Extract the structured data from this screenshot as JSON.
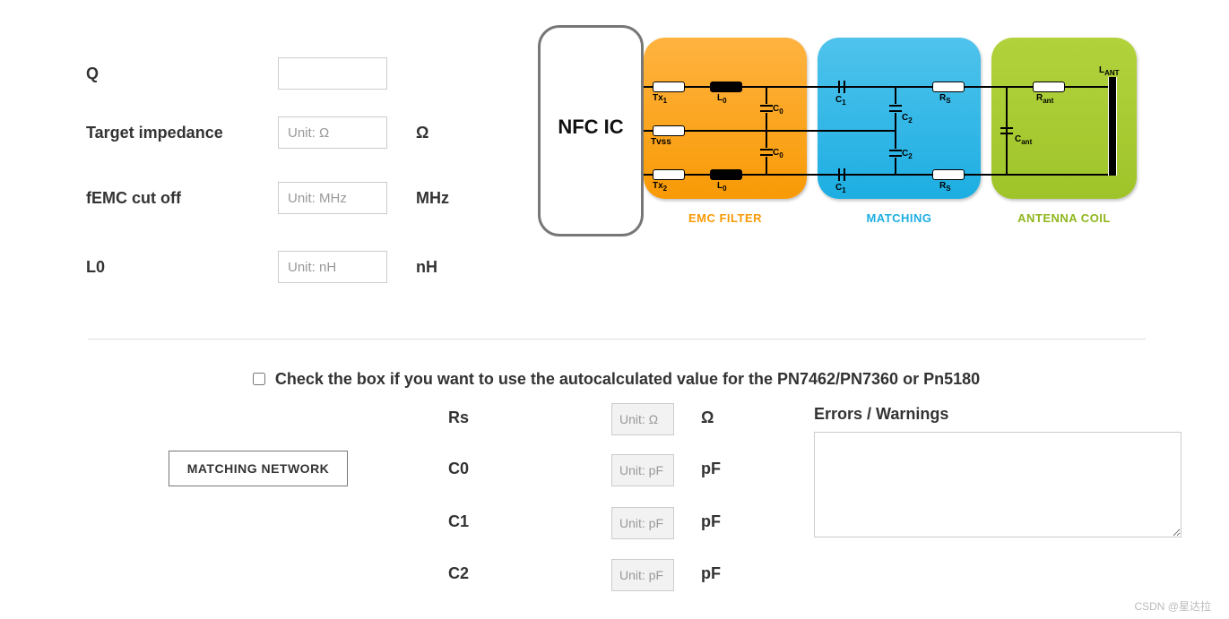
{
  "params": {
    "q": {
      "label": "Q",
      "placeholder": "",
      "unit": ""
    },
    "zt": {
      "label": "Target impedance",
      "placeholder": "Unit: Ω",
      "unit": "Ω"
    },
    "femc": {
      "label": "fEMC cut off",
      "placeholder": "Unit: MHz",
      "unit": "MHz"
    },
    "l0": {
      "label": "L0",
      "placeholder": "Unit: nH",
      "unit": "nH"
    }
  },
  "diagram": {
    "nfc_ic": "NFC IC",
    "stage_emc": "EMC FILTER",
    "stage_match": "MATCHING",
    "stage_ant": "ANTENNA COIL",
    "labels": {
      "tx1": "Tx",
      "tx1_sub": "1",
      "tx2": "Tx",
      "tx2_sub": "2",
      "tvss": "Tvss",
      "l0": "L",
      "l0_sub": "0",
      "c0": "C",
      "c0_sub": "0",
      "c1": "C",
      "c1_sub": "1",
      "c2": "C",
      "c2_sub": "2",
      "rs": "R",
      "rs_sub": "S",
      "rant": "R",
      "rant_sub": "ant",
      "cant": "C",
      "cant_sub": "ant",
      "lant": "L",
      "lant_sub": "ANT"
    }
  },
  "autocalc": {
    "text": "Check the box if you want to use the autocalculated value for the PN7462/PN7360 or Pn5180"
  },
  "matching_button": "MATCHING NETWORK",
  "outputs": {
    "rs": {
      "label": "Rs",
      "placeholder": "Unit: Ω",
      "unit": "Ω"
    },
    "c0": {
      "label": "C0",
      "placeholder": "Unit: pF",
      "unit": "pF"
    },
    "c1": {
      "label": "C1",
      "placeholder": "Unit: pF",
      "unit": "pF"
    },
    "c2": {
      "label": "C2",
      "placeholder": "Unit: pF",
      "unit": "pF"
    }
  },
  "errwarn_title": "Errors / Warnings",
  "watermark": "CSDN @星达拉"
}
